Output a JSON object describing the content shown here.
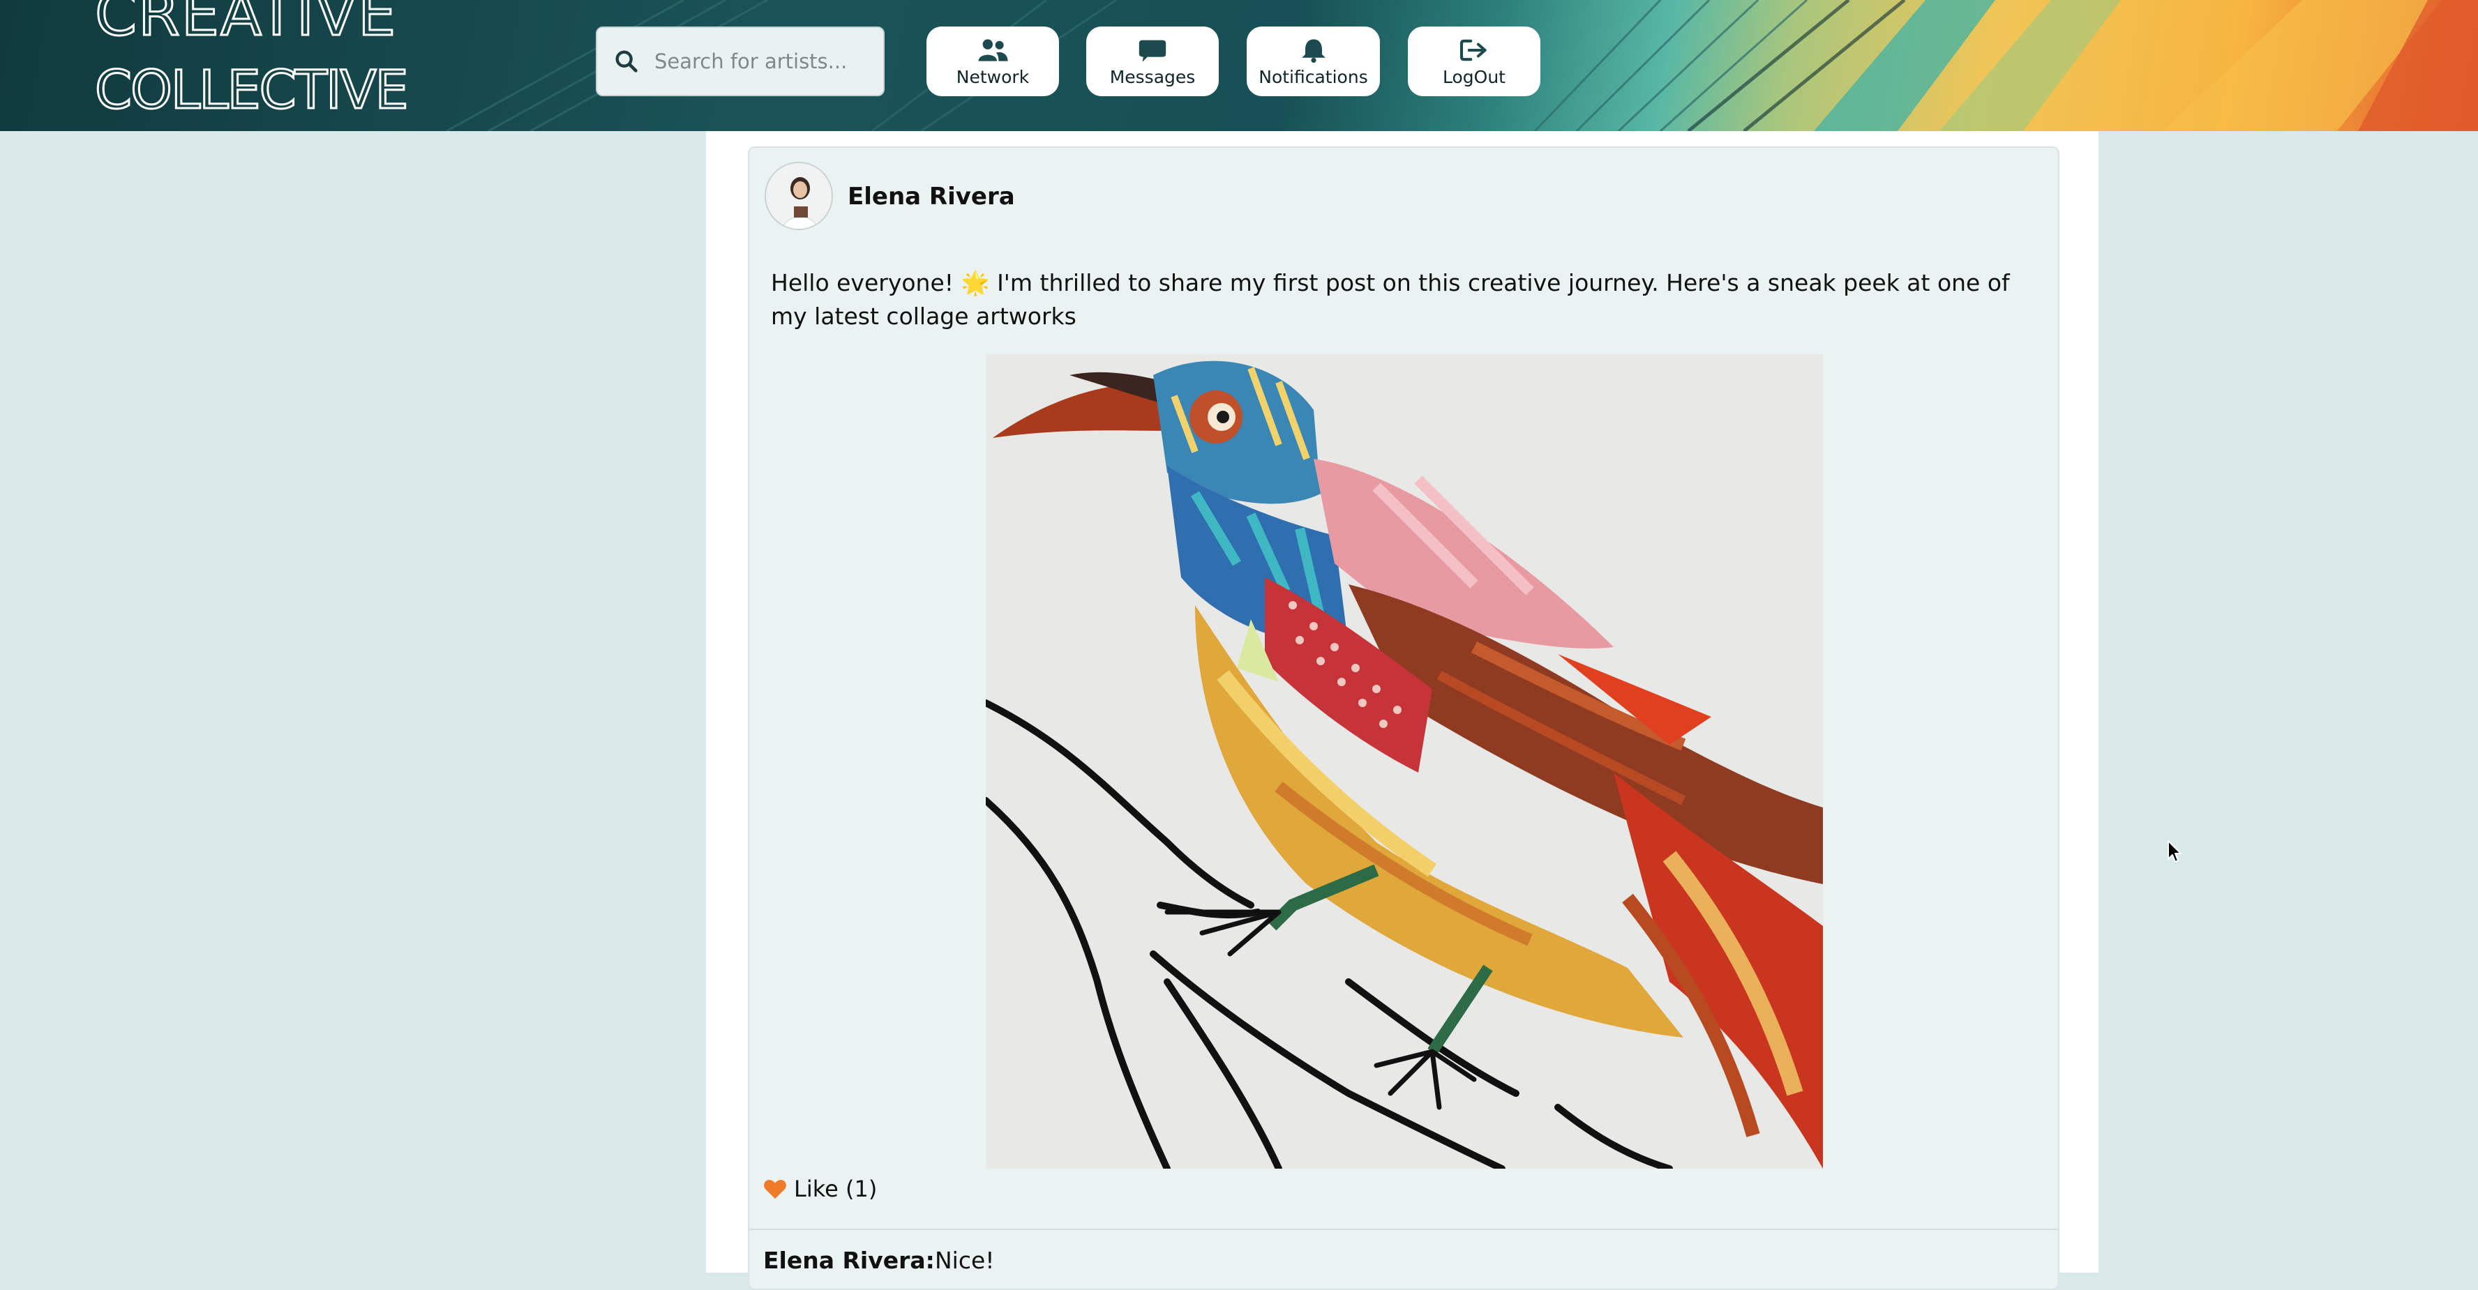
{
  "header": {
    "logo_line1": "CREATIVE",
    "logo_line2": "COLLECTIVE",
    "search": {
      "placeholder": "Search for artists..."
    },
    "nav": {
      "network": {
        "label": "Network",
        "icon": "users-icon"
      },
      "messages": {
        "label": "Messages",
        "icon": "chat-bubble-icon"
      },
      "notifications": {
        "label": "Notifications",
        "icon": "bell-icon"
      },
      "logout": {
        "label": "LogOut",
        "icon": "logout-icon"
      }
    }
  },
  "post": {
    "author": "Elena Rivera",
    "text": "Hello everyone! 🌟 I'm thrilled to share my first post on this creative journey. Here's a sneak peek at one of my latest collage artworks",
    "image": "collage-bird-artwork",
    "like": {
      "icon": "heart-icon",
      "label": "Like (1)"
    },
    "comments": [
      {
        "author": "Elena Rivera:",
        "text": "Nice!"
      }
    ]
  },
  "colors": {
    "page_bg": "#d9e9e9",
    "post_bg": "#eaf3f2",
    "accent_heart": "#ee7a2a",
    "header_dark": "#123c40"
  }
}
